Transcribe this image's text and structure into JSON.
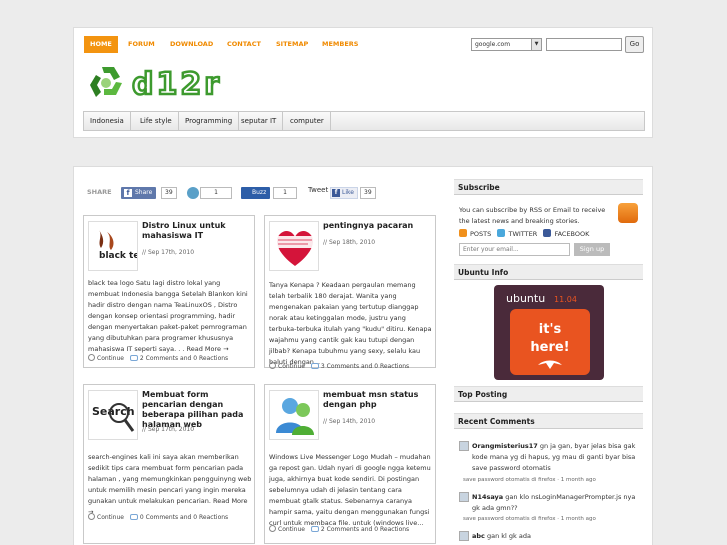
{
  "header": {
    "topnav": [
      "HOME",
      "FORUM",
      "DOWNLOAD",
      "CONTACT",
      "SITEMAP",
      "MEMBERS"
    ],
    "search": {
      "engine": "google.com",
      "input_value": "",
      "go_label": "Go"
    },
    "logo_text": "d12r",
    "categories": [
      "Indonesia",
      "Life style",
      "Programming",
      "seputar IT",
      "computer"
    ]
  },
  "share": {
    "label": "SHARE",
    "facebook_share": "Share",
    "facebook_count": "39",
    "count2": "1",
    "buzz_label": "Buzz",
    "buzz_count": "1",
    "tweet_label": "Tweet",
    "like_label": "Like",
    "like_count": "39"
  },
  "posts": [
    {
      "title": "Distro Linux untuk mahasiswa IT",
      "date": "// Sep 17th, 2010",
      "excerpt": "black tea logo Satu lagi distro lokal yang membuat Indonesia bangga Setelah Blankon kini hadir distro dengan nama TeaLinuxOS , Distro dengan konsep orientasi programming, hadir dengan menyertakan paket-paket pemrograman yang dibutuhkan para programer khususnya mahasiswa IT seperti saya. . . Read More →",
      "continue": "Continue",
      "comments": "2 Comments and 0 Reactions",
      "thumb_text": "black tea"
    },
    {
      "title": "pentingnya pacaran",
      "date": "// Sep 18th, 2010",
      "excerpt": "Tanya Kenapa ? Keadaan pergaulan memang telah terbalik 180 derajat. Wanita yang mengenakan pakaian yang tertutup dianggap norak atau ketinggalan mode, justru yang terbuka-terbuka itulah yang \"kudu\" ditiru. Kenapa wajahmu yang cantik gak kau tutupi dengan jilbab? Kenapa tubuhmu yang sexy, selalu kau baluti dengan...",
      "continue": "Continue",
      "comments": "3 Comments and 0 Reactions",
      "thumb_text": ""
    },
    {
      "title": "Membuat form pencarian dengan beberapa pilihan pada halaman web",
      "date": "// Sep 17th, 2010",
      "excerpt": "search-engines kali ini saya akan memberikan sedikit tips cara membuat form pencarian pada halaman , yang memungkinkan pengguinyng web untuk memilih mesin pencari yang ingin mereka gunakan untuk melakukan pencarian. Read More →",
      "continue": "Continue",
      "comments": "0 Comments and 0 Reactions",
      "thumb_text": "Search"
    },
    {
      "title": "membuat msn status dengan php",
      "date": "// Sep 14th, 2010",
      "excerpt": "Windows Live Messenger Logo Mudah – mudahan ga repost gan. Udah nyari di google ngga ketemu juga, akhirnya buat kode sendiri. Di postingan sebelumnya udah di jelasin tentang cara membuat gtalk status. Sebenarnya caranya hampir sama, yaitu dengan menggunakan fungsi curl untuk membaca file. untuk (windows live...",
      "continue": "Continue",
      "comments": "2 Comments and 0 Reactions",
      "thumb_text": ""
    }
  ],
  "sidebar": {
    "subscribe_title": "Subscribe",
    "subscribe_text": "You can subscribe by RSS or Email to receive the latest news and breaking stories.",
    "posts_link": "POSTS",
    "twitter_link": "TWITTER",
    "facebook_link": "FACEBOOK",
    "email_placeholder": "Enter your email...",
    "signup": "Sign up",
    "ubuntu_title": "Ubuntu Info",
    "ubuntu_ad": {
      "brand": "ubuntu",
      "version": "11.04",
      "line1": "it's",
      "line2": "here!"
    },
    "top_posting_title": "Top Posting",
    "recent_comments_title": "Recent Comments",
    "comments": [
      {
        "author": "Orangmisterius17",
        "text": "gn ja gan, byar jelas bisa gak kode mana yg di hapus, yg mau di ganti byar bisa save password otomatis",
        "meta": "save password otomatis di firefox · 1 month ago"
      },
      {
        "author": "N14saya",
        "text": "gan klo nsLoginManagerPrompter.js nya gk ada gmn??",
        "meta": "save password otomatis di firefox · 1 month ago"
      },
      {
        "author": "abc",
        "text": "gan kl gk ada",
        "meta": ""
      }
    ]
  },
  "colors": {
    "accent": "#f39410",
    "link_blue": "#3b5998"
  }
}
